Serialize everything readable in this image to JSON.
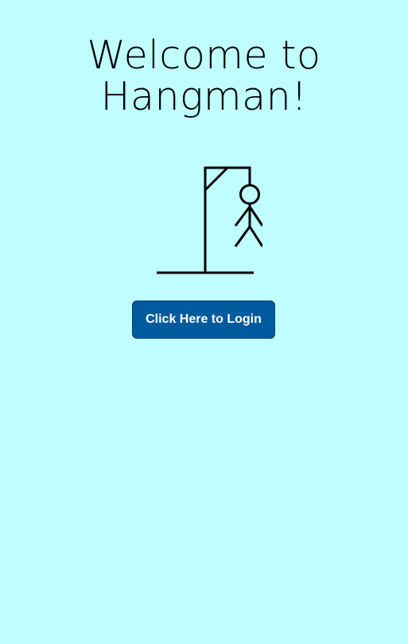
{
  "header": {
    "title_line1": "Welcome to",
    "title_line2": "Hangman!"
  },
  "illustration": {
    "icon": "hangman-icon"
  },
  "actions": {
    "login_label": "Click Here to Login"
  },
  "colors": {
    "background": "#bffdff",
    "button": "#005a9e",
    "button_text": "#ffffff",
    "drawing": "#000000"
  }
}
